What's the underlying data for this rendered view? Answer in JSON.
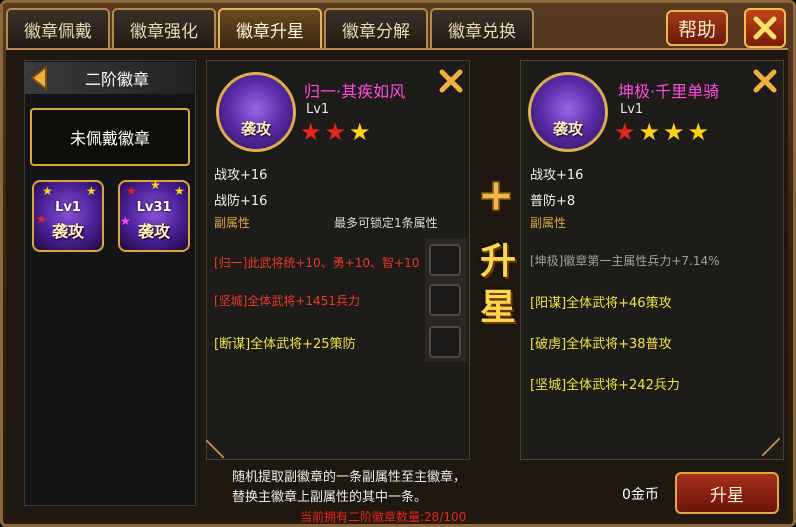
{
  "tabs": [
    {
      "label": "徽章佩戴",
      "active": false
    },
    {
      "label": "徽章强化",
      "active": false
    },
    {
      "label": "徽章升星",
      "active": true
    },
    {
      "label": "徽章分解",
      "active": false
    },
    {
      "label": "徽章兑换",
      "active": false
    }
  ],
  "header": {
    "help_label": "帮助",
    "close_icon": "close-icon"
  },
  "left": {
    "tier_title": "二阶徽章",
    "unequipped_label": "未佩戴徽章",
    "badges": [
      {
        "level": "Lv1",
        "name": "袭攻"
      },
      {
        "level": "Lv31",
        "name": "袭攻"
      }
    ]
  },
  "main_badge": {
    "name": "归一·其疾如风",
    "level": "Lv1",
    "stars": {
      "red": 2,
      "gold": 1
    },
    "badge_text": "袭攻",
    "stat1": "战攻+16",
    "stat2": "战防+16",
    "sub_heading": "副属性",
    "lock_note": "最多可锁定1条属性",
    "sub1": "[归一]此武将统+10、勇+10、智+10",
    "sub2": "[坚城]全体武将+1451兵力",
    "sub3": "[断谋]全体武将+25策防"
  },
  "target_badge": {
    "name": "坤极·千里单骑",
    "level": "Lv1",
    "stars": {
      "red": 1,
      "gold": 3
    },
    "badge_text": "袭攻",
    "stat1": "战攻+16",
    "stat2": "普防+8",
    "sub_heading": "副属性",
    "sub1": "[坤极]徽章第一主属性兵力+7.14%",
    "sub2": "[阳谋]全体武将+46策攻",
    "sub3": "[破虏]全体武将+38普攻",
    "sub4": "[坚城]全体武将+242兵力"
  },
  "upstar_title": "升星",
  "footer": {
    "desc_line1": "随机提取副徽章的一条副属性至主徽章，",
    "desc_line2": "替换主徽章上副属性的其中一条。",
    "count_note": "当前拥有二阶徽章数量:28/100",
    "gold": "0金币",
    "upstar_button": "升星"
  },
  "colors": {
    "accent_gold": "#d8a83a",
    "name_pink": "#ff4ce0",
    "red": "#e8251a",
    "yellow": "#f0e24a"
  }
}
